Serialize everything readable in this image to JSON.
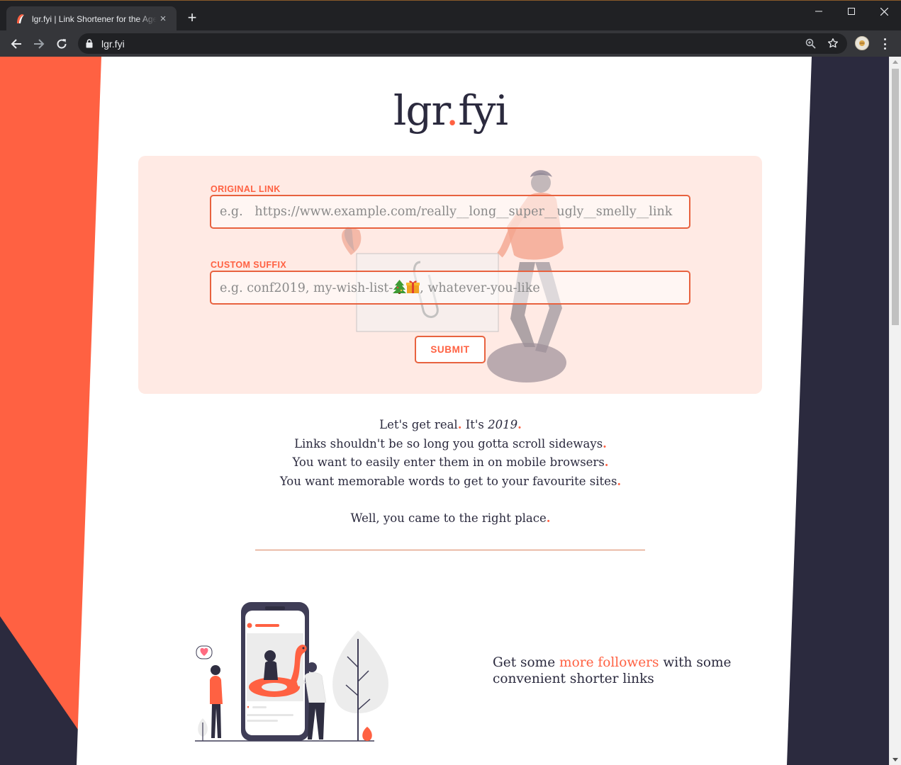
{
  "browser": {
    "tab_title": "lgr.fyi | Link Shortener for the Ages",
    "url": "lgr.fyi",
    "new_tab": "+",
    "tab_close": "×"
  },
  "logo": {
    "left": "lgr",
    "dot": ".",
    "right": "fyi"
  },
  "form": {
    "original_link_label": "ORIGINAL LINK",
    "original_link_placeholder": "e.g.   https://www.example.com/really__long__super__ugly__smelly__link",
    "custom_suffix_label": "CUSTOM SUFFIX",
    "custom_suffix_placeholder_a": "e.g.   conf2019, my-wish-list-",
    "custom_suffix_placeholder_b": ", whatever-you-like",
    "submit_label": "SUBMIT"
  },
  "copy": {
    "line1_a": "Let's get real",
    "line1_b": " It's ",
    "line1_year": "2019",
    "line2": "Links shouldn't be so long you gotta scroll sideways",
    "line3": "You want to easily enter them in on mobile browsers",
    "line4": "You want memorable words to get to your favourite sites",
    "line5": "Well, you came to the right place",
    "period": "."
  },
  "followers": {
    "prefix": "Get some ",
    "highlight": "more followers",
    "suffix": " with some convenient shorter links"
  },
  "colors": {
    "accent": "#ff6142",
    "dark": "#2b2a3e",
    "card_bg": "#ffeae4"
  }
}
